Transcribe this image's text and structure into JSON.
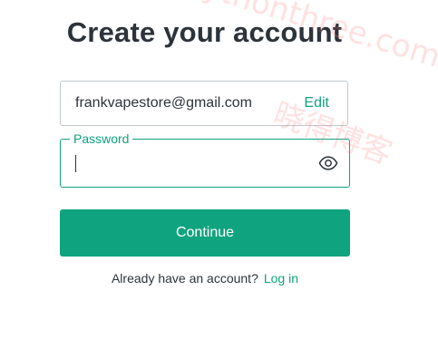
{
  "title": "Create your account",
  "email": {
    "value": "frankvapestore@gmail.com",
    "edit_label": "Edit"
  },
  "password": {
    "label": "Password",
    "value": ""
  },
  "continue_label": "Continue",
  "footer": {
    "text": "Already have an account?",
    "login_label": "Log in"
  },
  "watermark": {
    "url": "https://www.pythonthree.com",
    "site_name": "晓得博客"
  },
  "colors": {
    "accent": "#10a37f",
    "text": "#2d333a",
    "border": "#c2c8d0"
  }
}
